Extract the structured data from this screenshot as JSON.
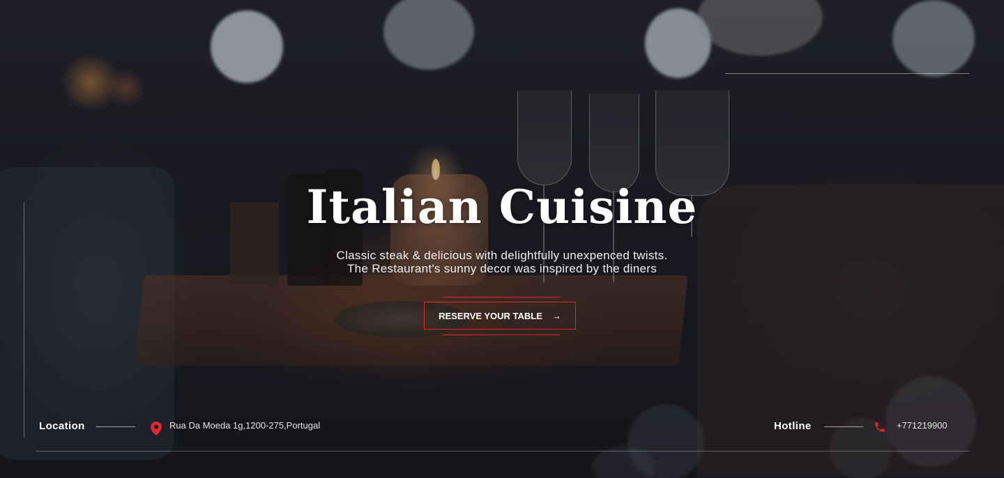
{
  "hero": {
    "title": "Italian Cuisine",
    "subtitle_line1": "Classic steak & delicious with delightfully unexpenced twists.",
    "subtitle_line2": "The Restaurant's sunny decor was inspired by the diners",
    "cta_label": "RESERVE YOUR TABLE",
    "cta_arrow": "→"
  },
  "info": {
    "location_label": "Location",
    "location_value": "Rua Da Moeda 1g,1200-275,Portugal",
    "location_icon": "map-pin-icon",
    "hotline_label": "Hotline",
    "hotline_value": "+771219900",
    "hotline_icon": "phone-icon"
  },
  "colors": {
    "accent": "#e0282f",
    "text": "#ffffff",
    "background": "#1a1b22"
  }
}
